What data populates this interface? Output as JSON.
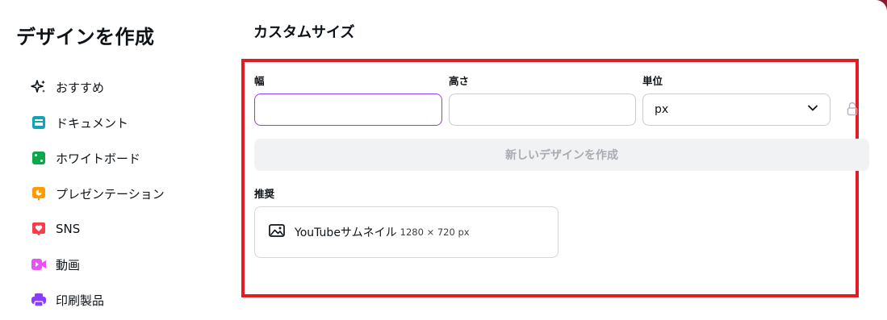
{
  "sidebar": {
    "title": "デザインを作成",
    "items": [
      {
        "label": "おすすめ",
        "icon": "sparkle-icon",
        "color": "#0e1318"
      },
      {
        "label": "ドキュメント",
        "icon": "document-icon",
        "color": "#13a3b5"
      },
      {
        "label": "ホワイトボード",
        "icon": "whiteboard-icon",
        "color": "#0ba84a"
      },
      {
        "label": "プレゼンテーション",
        "icon": "presentation-icon",
        "color": "#ff9a00"
      },
      {
        "label": "SNS",
        "icon": "heart-icon",
        "color": "#ff3b4b"
      },
      {
        "label": "動画",
        "icon": "video-icon",
        "color": "#e950f7"
      },
      {
        "label": "印刷製品",
        "icon": "printer-icon",
        "color": "#8b3dff"
      }
    ]
  },
  "custom_size": {
    "title": "カスタムサイズ",
    "width_label": "幅",
    "width_value": "",
    "height_label": "高さ",
    "height_value": "",
    "unit_label": "単位",
    "unit_value": "px",
    "create_button": "新しいデザインを作成",
    "recommended_label": "推奨",
    "recommended": {
      "name": "YouTubeサムネイル",
      "size": "1280 × 720 px",
      "icon": "image-icon"
    }
  },
  "colors": {
    "accent": "#8b3dff",
    "highlight_border": "#e31b23",
    "background": "#8b1a2b"
  }
}
